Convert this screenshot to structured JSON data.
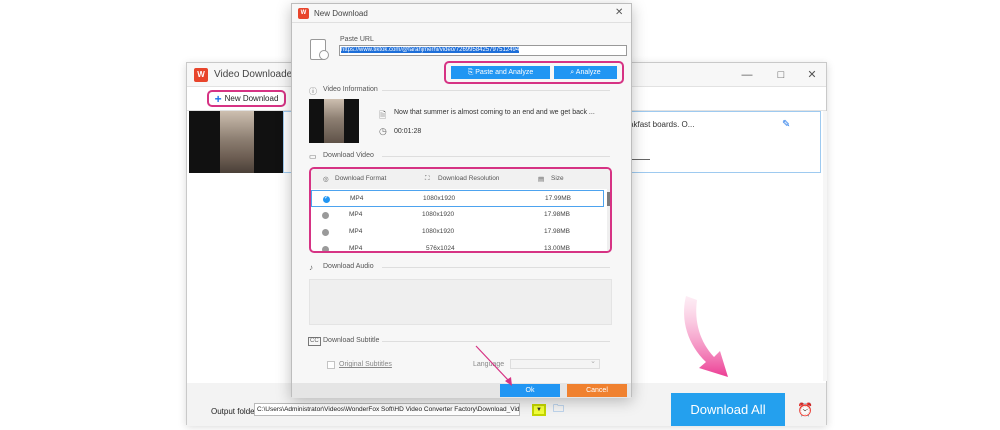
{
  "main_window": {
    "title": "Video Downloader",
    "controls": {
      "minimize": "—",
      "maximize": "□",
      "close": "✕"
    },
    "toolbar": {
      "new_download_label": "New Download"
    },
    "task": {
      "title_tail": "oking forward to Sunday breakfast boards. O..."
    },
    "bottom": {
      "output_label": "Output folder:",
      "output_path": "C:\\Users\\Administrator\\Videos\\WonderFox Soft\\HD Video Converter Factory\\Download_Video\\",
      "download_all_label": "Download All"
    }
  },
  "dialog": {
    "title": "New Download",
    "close": "✕",
    "paste_url_label": "Paste URL",
    "url_value": "https://www.tiktok.com/@farahjmerhi/video/7269958425797512494",
    "paste_analyze_label": "Paste and Analyze",
    "analyze_label": "Analyze",
    "video_info_label": "Video Information",
    "video_title": "Now that summer is almost coming to an end and we get back ...",
    "video_duration": "00:01:28",
    "download_video_label": "Download Video",
    "headers": {
      "format": "Download Format",
      "resolution": "Download Resolution",
      "size": "Size"
    },
    "formats": [
      {
        "format": "MP4",
        "resolution": "1080x1920",
        "size": "17.99MB",
        "selected": true
      },
      {
        "format": "MP4",
        "resolution": "1080x1920",
        "size": "17.98MB",
        "selected": false
      },
      {
        "format": "MP4",
        "resolution": "1080x1920",
        "size": "17.98MB",
        "selected": false
      },
      {
        "format": "MP4",
        "resolution": "576x1024",
        "size": "13.00MB",
        "selected": false
      }
    ],
    "download_audio_label": "Download Audio",
    "download_subtitle_label": "Download Subtitle",
    "original_subtitles_label": "Original Subtitles",
    "language_label": "Language",
    "ok_label": "Ok",
    "cancel_label": "Cancel"
  },
  "colors": {
    "accent": "#2196f3",
    "highlight": "#d63384",
    "cancel": "#f0812f",
    "brand": "#e8452c"
  },
  "icons": {
    "url": "link-file-icon",
    "info": "info-icon",
    "video": "video-icon",
    "audio": "music-note-icon",
    "subtitle": "cc-icon",
    "folder": "folder-icon",
    "alarm": "alarm-clock-icon"
  }
}
